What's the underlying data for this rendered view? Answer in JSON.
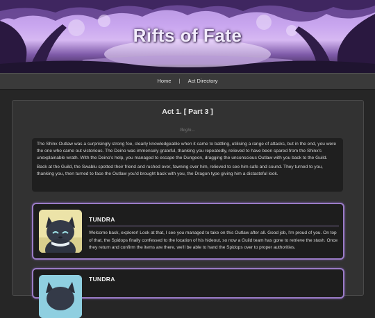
{
  "site": {
    "title": "Rifts of Fate"
  },
  "nav": {
    "home": "Home",
    "separator": "|",
    "act_directory": "Act Directory"
  },
  "chapter": {
    "heading": "Act 1. [ Part 3 ]",
    "begin_marker": "Begin..."
  },
  "story": {
    "paragraphs": [
      "The Shinx Outlaw was a surprisingly strong foe, clearly knowledgeable when it came to battling, utilising a range of attacks, but in the end, you were the one who came out victorious. The Deino was immensely grateful, thanking you repeatedly, relieved to have been spared from the Shinx's unexplainable wrath. With the Deino's help, you managed to escape the Dungeon, dragging the unconscious Outlaw with you back to the Guild.",
      "Back at the Guild, the Swablu spotted their friend and rushed over, fawning over him, relieved to see him safe and sound. They turned to you, thanking you, then turned to face the Outlaw you'd brought back with you, the Dragon type giving him a distasteful look."
    ]
  },
  "dialogues": [
    {
      "speaker": "TUNDRA",
      "text": "Welcome back, explorer! Look at that, I see you managed to take on this Outlaw after all. Good job, I'm proud of you. On top of that, the Spidops finally confessed to the location of his hideout, so now a Guild team has gone to retrieve the stash. Once they return and confirm the items are there, we'll be able to hand the Spidops over to proper authorities."
    },
    {
      "speaker": "TUNDRA"
    }
  ],
  "colors": {
    "page_background": "#262626",
    "panel_background": "#323232",
    "card_border": "#9b7cc7",
    "nav_background": "#3a3a3a"
  },
  "icons": {
    "portrait": "dark-cat-character-portrait"
  }
}
